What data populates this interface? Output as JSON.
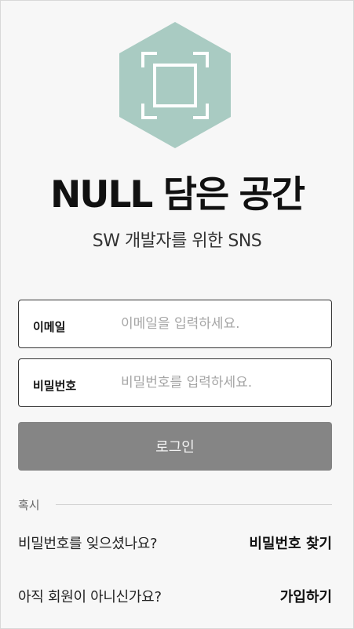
{
  "brand": {
    "title": "NULL 담은 공간",
    "subtitle": "SW 개발자를 위한 SNS",
    "logo_icon": "hexagon-frame-icon",
    "logo_color": "#a9cbc2"
  },
  "form": {
    "email": {
      "label": "이메일",
      "placeholder": "이메일을 입력하세요.",
      "value": ""
    },
    "password": {
      "label": "비밀번호",
      "placeholder": "비밀번호를 입력하세요.",
      "value": ""
    },
    "login_label": "로그인"
  },
  "help": {
    "divider_label": "혹시",
    "find_password_question": "비밀번호를 잊으셨나요?",
    "find_password_link": "비밀번호 찾기",
    "signup_question": "아직 회원이 아니신가요?",
    "signup_link": "가입하기"
  }
}
